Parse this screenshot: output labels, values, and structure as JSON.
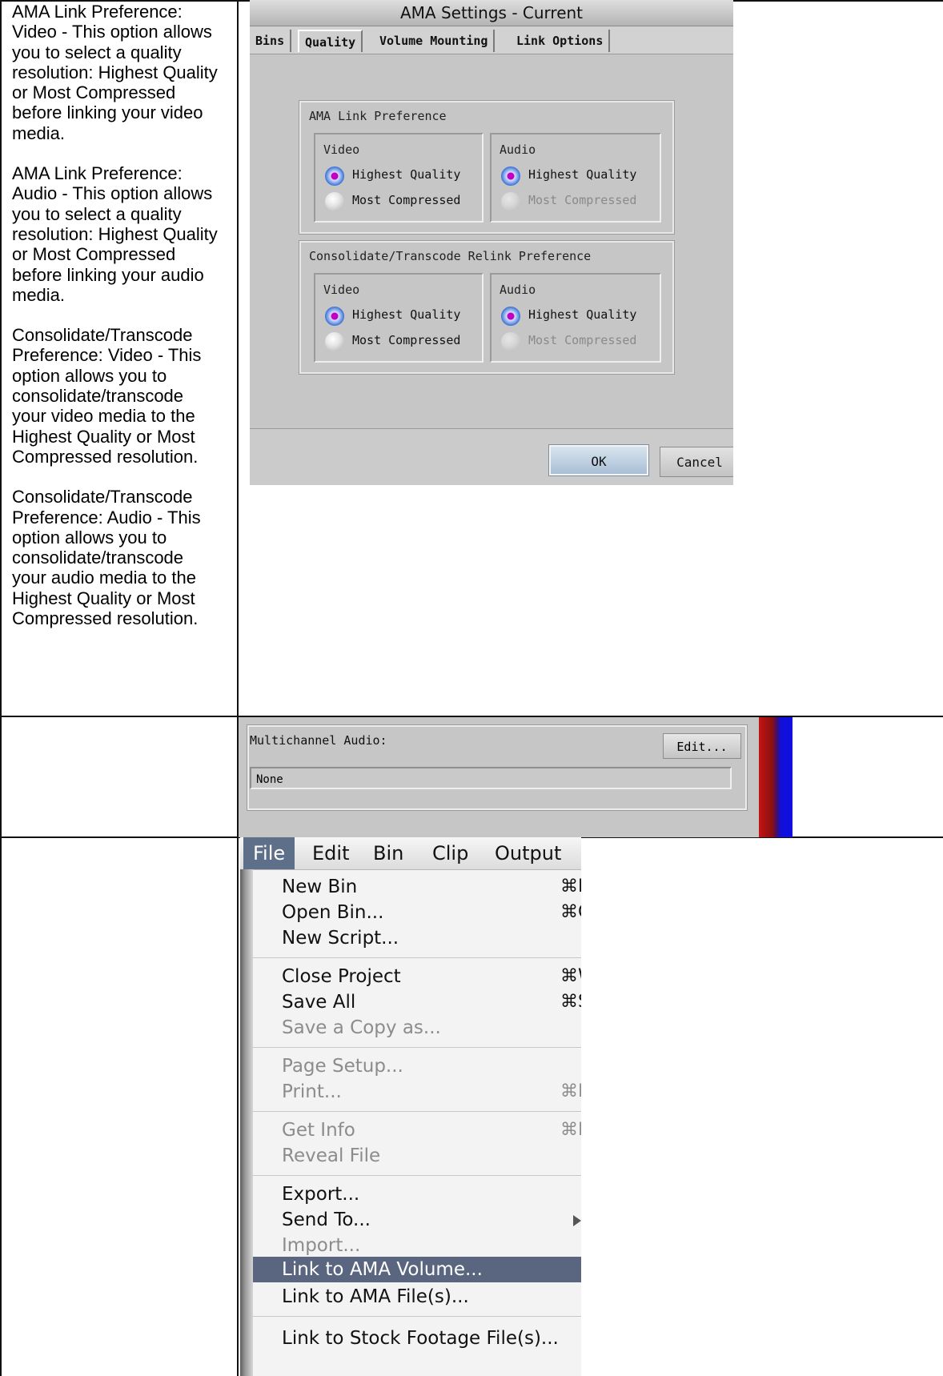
{
  "descriptions": [
    "AMA Link Preference: Video - This option allows you to select a quality resolution: Highest Quality or Most Compressed before linking your video media.",
    "AMA Link Preference: Audio - This option allows you to select a quality resolution: Highest Quality or Most Compressed before linking your audio media.",
    "Consolidate/Transcode Preference: Video - This option allows you to consolidate/transcode your video media to the Highest Quality or Most Compressed resolution.",
    "Consolidate/Transcode Preference: Audio - This option allows you to consolidate/transcode your audio media to the Highest Quality or Most Compressed resolution."
  ],
  "dialog": {
    "title": "AMA Settings - Current",
    "tabs": [
      {
        "label": "Bins",
        "active": false
      },
      {
        "label": "Quality",
        "active": true
      },
      {
        "label": "Volume Mounting",
        "active": false
      },
      {
        "label": "Link Options",
        "active": false
      }
    ],
    "groups": [
      {
        "title": "AMA Link Preference",
        "video": {
          "label": "Video",
          "options": [
            "Highest Quality",
            "Most Compressed"
          ],
          "selected": "Highest Quality"
        },
        "audio": {
          "label": "Audio",
          "options": [
            "Highest Quality",
            "Most Compressed"
          ],
          "selected": "Highest Quality",
          "disabled": [
            "Most Compressed"
          ]
        }
      },
      {
        "title": "Consolidate/Transcode Relink Preference",
        "video": {
          "label": "Video",
          "options": [
            "Highest Quality",
            "Most Compressed"
          ],
          "selected": "Highest Quality"
        },
        "audio": {
          "label": "Audio",
          "options": [
            "Highest Quality",
            "Most Compressed"
          ],
          "selected": "Highest Quality",
          "disabled": [
            "Most Compressed"
          ]
        }
      }
    ],
    "ok_label": "OK",
    "cancel_label": "Cancel"
  },
  "multichannel": {
    "label": "Multichannel Audio:",
    "edit_label": "Edit...",
    "value": "None"
  },
  "file_menu": {
    "menubar": [
      "File",
      "Edit",
      "Bin",
      "Clip",
      "Output"
    ],
    "active": "File",
    "items": [
      {
        "label": "New Bin",
        "shortcut": "⌘N",
        "enabled": true
      },
      {
        "label": "Open Bin...",
        "shortcut": "⌘O",
        "enabled": true
      },
      {
        "label": "New Script...",
        "shortcut": "",
        "enabled": true
      },
      {
        "label": "Close Project",
        "shortcut": "⌘W",
        "enabled": true
      },
      {
        "label": "Save All",
        "shortcut": "⌘S",
        "enabled": true
      },
      {
        "label": "Save a Copy as...",
        "shortcut": "",
        "enabled": false
      },
      {
        "label": "Page Setup...",
        "shortcut": "",
        "enabled": false
      },
      {
        "label": "Print...",
        "shortcut": "⌘P",
        "enabled": false
      },
      {
        "label": "Get Info",
        "shortcut": "⌘I",
        "enabled": false
      },
      {
        "label": "Reveal File",
        "shortcut": "",
        "enabled": false
      },
      {
        "label": "Export...",
        "shortcut": "",
        "enabled": true
      },
      {
        "label": "Send To...",
        "shortcut": "",
        "enabled": true,
        "submenu": true
      },
      {
        "label": "Import...",
        "shortcut": "",
        "enabled": false
      },
      {
        "label": "Link to AMA Volume...",
        "shortcut": "",
        "enabled": true,
        "highlighted": true
      },
      {
        "label": "Link to AMA File(s)...",
        "shortcut": "",
        "enabled": true
      },
      {
        "label": "Link to Stock Footage File(s)...",
        "shortcut": "",
        "enabled": true
      }
    ],
    "colors": {
      "highlight": "#5a6680",
      "active_menu": "#5e6f8a"
    }
  }
}
